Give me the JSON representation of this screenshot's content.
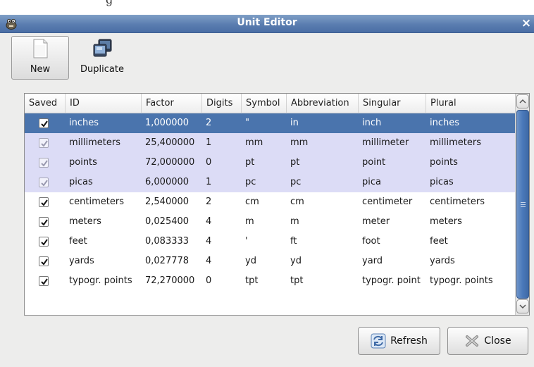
{
  "dialog": {
    "title": "Unit Editor",
    "close_glyph": "×"
  },
  "background_window": {
    "partial_text": "g"
  },
  "toolbar": {
    "new_label": "New",
    "duplicate_label": "Duplicate"
  },
  "table": {
    "columns": [
      "Saved",
      "ID",
      "Factor",
      "Digits",
      "Symbol",
      "Abbreviation",
      "Singular",
      "Plural"
    ],
    "rows": [
      {
        "saved": true,
        "id": "inches",
        "factor": "1,000000",
        "digits": "2",
        "symbol": "\"",
        "abbreviation": "in",
        "singular": "inch",
        "plural": "inches",
        "state": "selected"
      },
      {
        "saved": true,
        "id": "millimeters",
        "factor": "25,400000",
        "digits": "1",
        "symbol": "mm",
        "abbreviation": "mm",
        "singular": "millimeter",
        "plural": "millimeters",
        "state": "system"
      },
      {
        "saved": true,
        "id": "points",
        "factor": "72,000000",
        "digits": "0",
        "symbol": "pt",
        "abbreviation": "pt",
        "singular": "point",
        "plural": "points",
        "state": "system"
      },
      {
        "saved": true,
        "id": "picas",
        "factor": "6,000000",
        "digits": "1",
        "symbol": "pc",
        "abbreviation": "pc",
        "singular": "pica",
        "plural": "picas",
        "state": "system"
      },
      {
        "saved": true,
        "id": "centimeters",
        "factor": "2,540000",
        "digits": "2",
        "symbol": "cm",
        "abbreviation": "cm",
        "singular": "centimeter",
        "plural": "centimeters",
        "state": "normal"
      },
      {
        "saved": true,
        "id": "meters",
        "factor": "0,025400",
        "digits": "4",
        "symbol": "m",
        "abbreviation": "m",
        "singular": "meter",
        "plural": "meters",
        "state": "normal"
      },
      {
        "saved": true,
        "id": "feet",
        "factor": "0,083333",
        "digits": "4",
        "symbol": "'",
        "abbreviation": "ft",
        "singular": "foot",
        "plural": "feet",
        "state": "normal"
      },
      {
        "saved": true,
        "id": "yards",
        "factor": "0,027778",
        "digits": "4",
        "symbol": "yd",
        "abbreviation": "yd",
        "singular": "yard",
        "plural": "yards",
        "state": "normal"
      },
      {
        "saved": true,
        "id": "typogr. points",
        "factor": "72,270000",
        "digits": "0",
        "symbol": "tpt",
        "abbreviation": "tpt",
        "singular": "typogr. point",
        "plural": "typogr. points",
        "state": "normal"
      }
    ]
  },
  "buttons": {
    "refresh_label": "Refresh",
    "close_label": "Close"
  },
  "colors": {
    "titlebar": "#5a7db0",
    "selection": "#4a74ad",
    "system_row": "#dcdcf6",
    "window_bg": "#ededec"
  },
  "icons": {
    "title": "gimp-icon",
    "new": "new-document-icon",
    "duplicate": "duplicate-icon",
    "refresh": "refresh-icon",
    "close": "close-icon"
  }
}
